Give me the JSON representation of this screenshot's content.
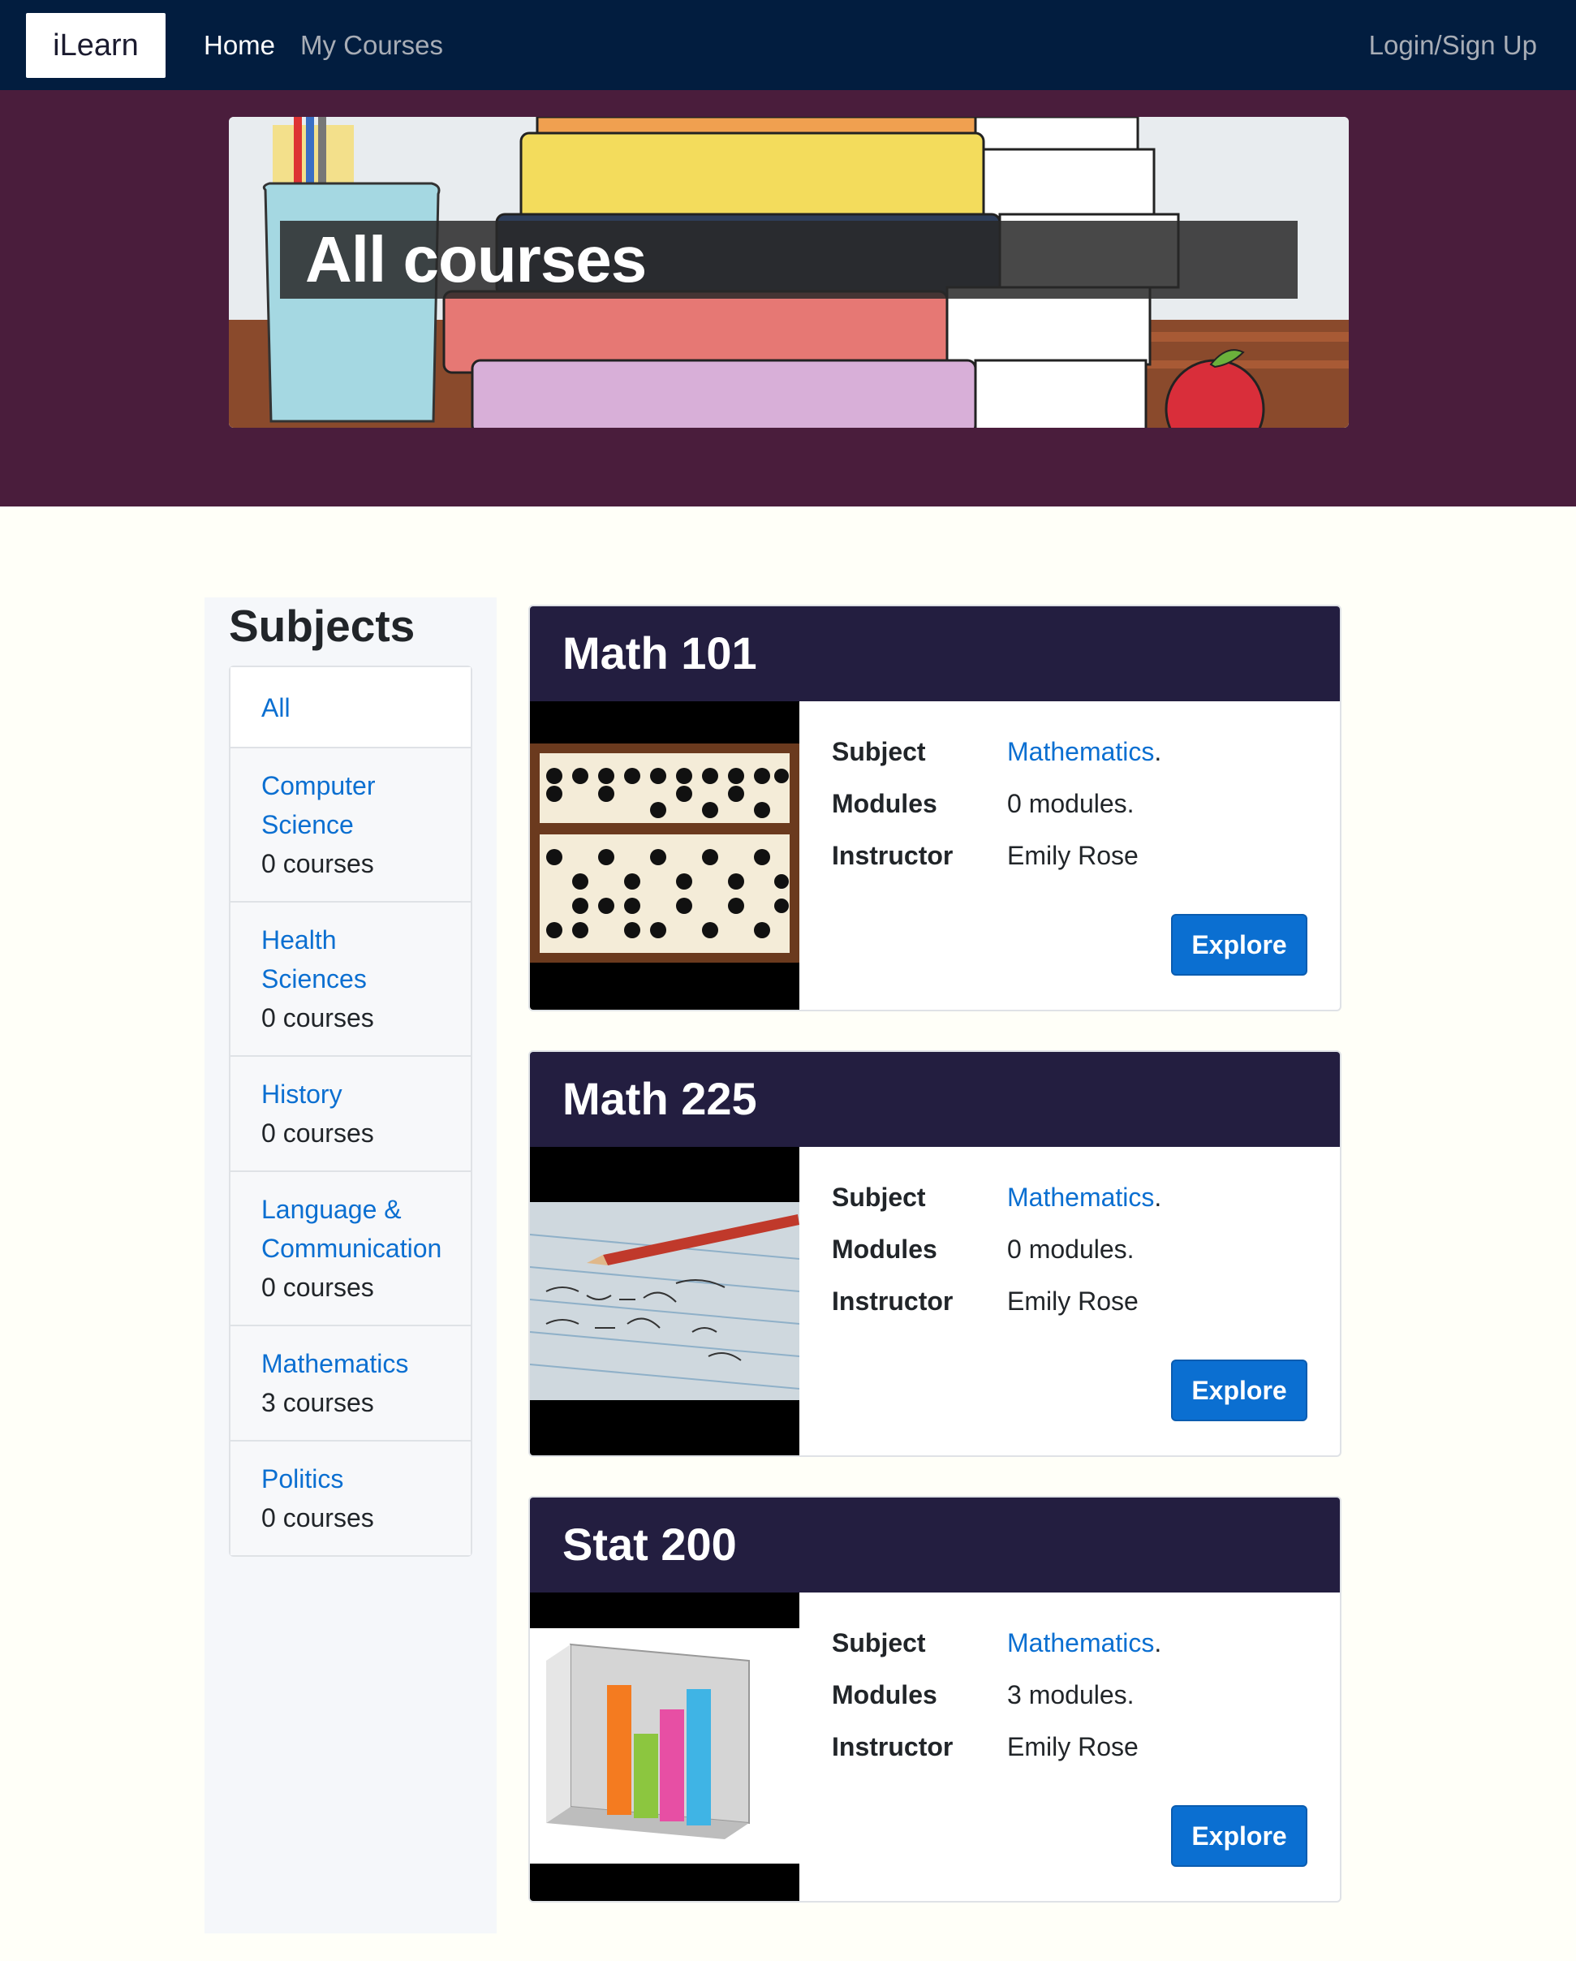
{
  "navbar": {
    "brand": "iLearn",
    "links": [
      {
        "label": "Home",
        "active": true
      },
      {
        "label": "My Courses",
        "active": false
      }
    ],
    "login_label": "Login/Sign Up",
    "background_color": "#021d3f"
  },
  "hero": {
    "title": "All courses",
    "background_color": "#4a1d3c"
  },
  "sidebar": {
    "title": "Subjects",
    "items": [
      {
        "label": "All",
        "count": ""
      },
      {
        "label": "Computer Science",
        "count": "0 courses"
      },
      {
        "label": "Health Sciences",
        "count": "0 courses"
      },
      {
        "label": "History",
        "count": "0 courses"
      },
      {
        "label": "Language & Communication",
        "count": "0 courses"
      },
      {
        "label": "Mathematics",
        "count": "3 courses"
      },
      {
        "label": "Politics",
        "count": "0 courses"
      }
    ]
  },
  "courses": [
    {
      "title": "Math 101",
      "image_icon": "abacus-image",
      "subject_label": "Subject",
      "subject": "Mathematics",
      "modules_label": "Modules",
      "modules": "0 modules.",
      "instructor_label": "Instructor",
      "instructor": "Emily Rose",
      "button_label": "Explore"
    },
    {
      "title": "Math 225",
      "image_icon": "pencil-notes-image",
      "subject_label": "Subject",
      "subject": "Mathematics",
      "modules_label": "Modules",
      "modules": "0 modules.",
      "instructor_label": "Instructor",
      "instructor": "Emily Rose",
      "button_label": "Explore"
    },
    {
      "title": "Stat 200",
      "image_icon": "bar-chart-image",
      "subject_label": "Subject",
      "subject": "Mathematics",
      "modules_label": "Modules",
      "modules": "3 modules.",
      "instructor_label": "Instructor",
      "instructor": "Emily Rose",
      "button_label": "Explore"
    }
  ],
  "colors": {
    "link": "#0b6fd1",
    "card_header": "#231e40",
    "button": "#0b6fd1"
  }
}
